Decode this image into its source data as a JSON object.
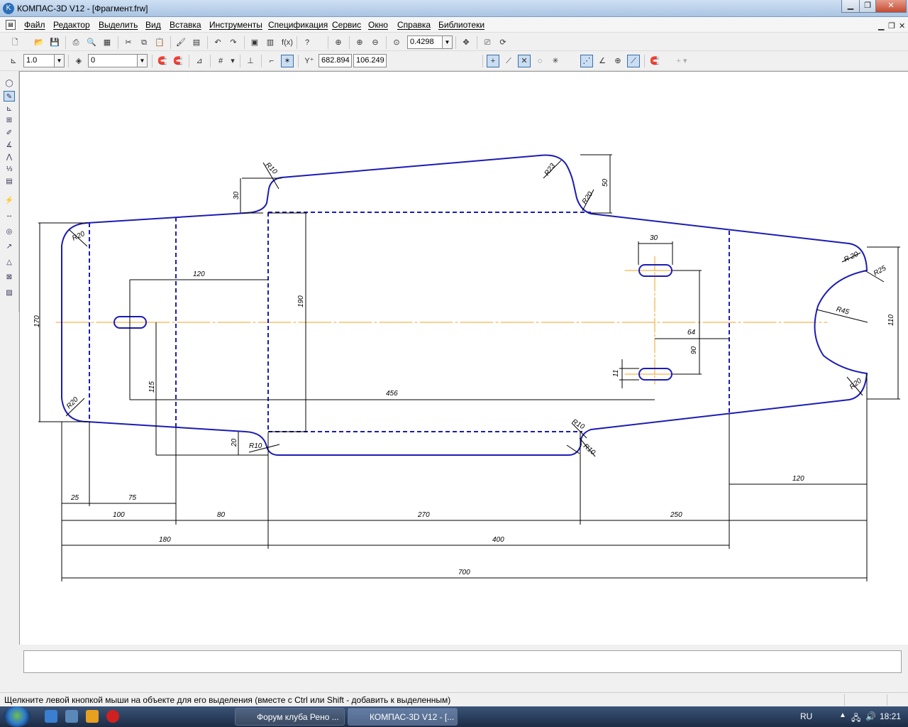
{
  "window": {
    "title": "КОМПАС-3D V12 - [Фрагмент.frw]",
    "buttons": {
      "minimize": "▁",
      "restore": "❐",
      "close": "✕"
    }
  },
  "menu": {
    "items": [
      "Файл",
      "Редактор",
      "Выделить",
      "Вид",
      "Вставка",
      "Инструменты",
      "Спецификация",
      "Сервис",
      "Окно",
      "Справка",
      "Библиотеки"
    ]
  },
  "toolbar1": {
    "zoom_value": "0.4298"
  },
  "toolbar2": {
    "line_scale": "1.0",
    "layer": "0",
    "coord_x": "682.894",
    "coord_y": "106.249"
  },
  "drawing": {
    "colors": {
      "contour": "#1c1cb4",
      "axis": "#f0a020",
      "dim": "#000000"
    },
    "dims": {
      "d30": "30",
      "d50": "50",
      "dR23": "R23",
      "dR20_top": "R20",
      "dR10_top": "R10",
      "d30_slot": "30",
      "dR20_r1": "R 20",
      "dR25": "R25",
      "dR45": "R45",
      "d110": "110",
      "d170": "170",
      "dR20_lt": "R20",
      "dR20_lb": "R20",
      "d120_top": "120",
      "d190": "190",
      "d64": "64",
      "d90": "90",
      "d11": "11",
      "d115": "115",
      "d456": "456",
      "dR20_rb": "R20",
      "d20": "20",
      "dR10_bl": "R10",
      "dR10_br1": "R10",
      "dR10_br2": "R10",
      "d120_right": "120",
      "d25": "25",
      "d75": "75",
      "d100": "100",
      "d80": "80",
      "d270": "270",
      "d250": "250",
      "d180": "180",
      "d400": "400",
      "d700": "700"
    }
  },
  "status": {
    "message": "Щелкните левой кнопкой мыши на объекте для его выделения (вместе с Ctrl или Shift - добавить к выделенным)"
  },
  "taskbar": {
    "tasks": [
      "Форум клуба Рено ...",
      "КОМПАС-3D V12 - [..."
    ],
    "lang": "RU",
    "time": "18:21"
  }
}
